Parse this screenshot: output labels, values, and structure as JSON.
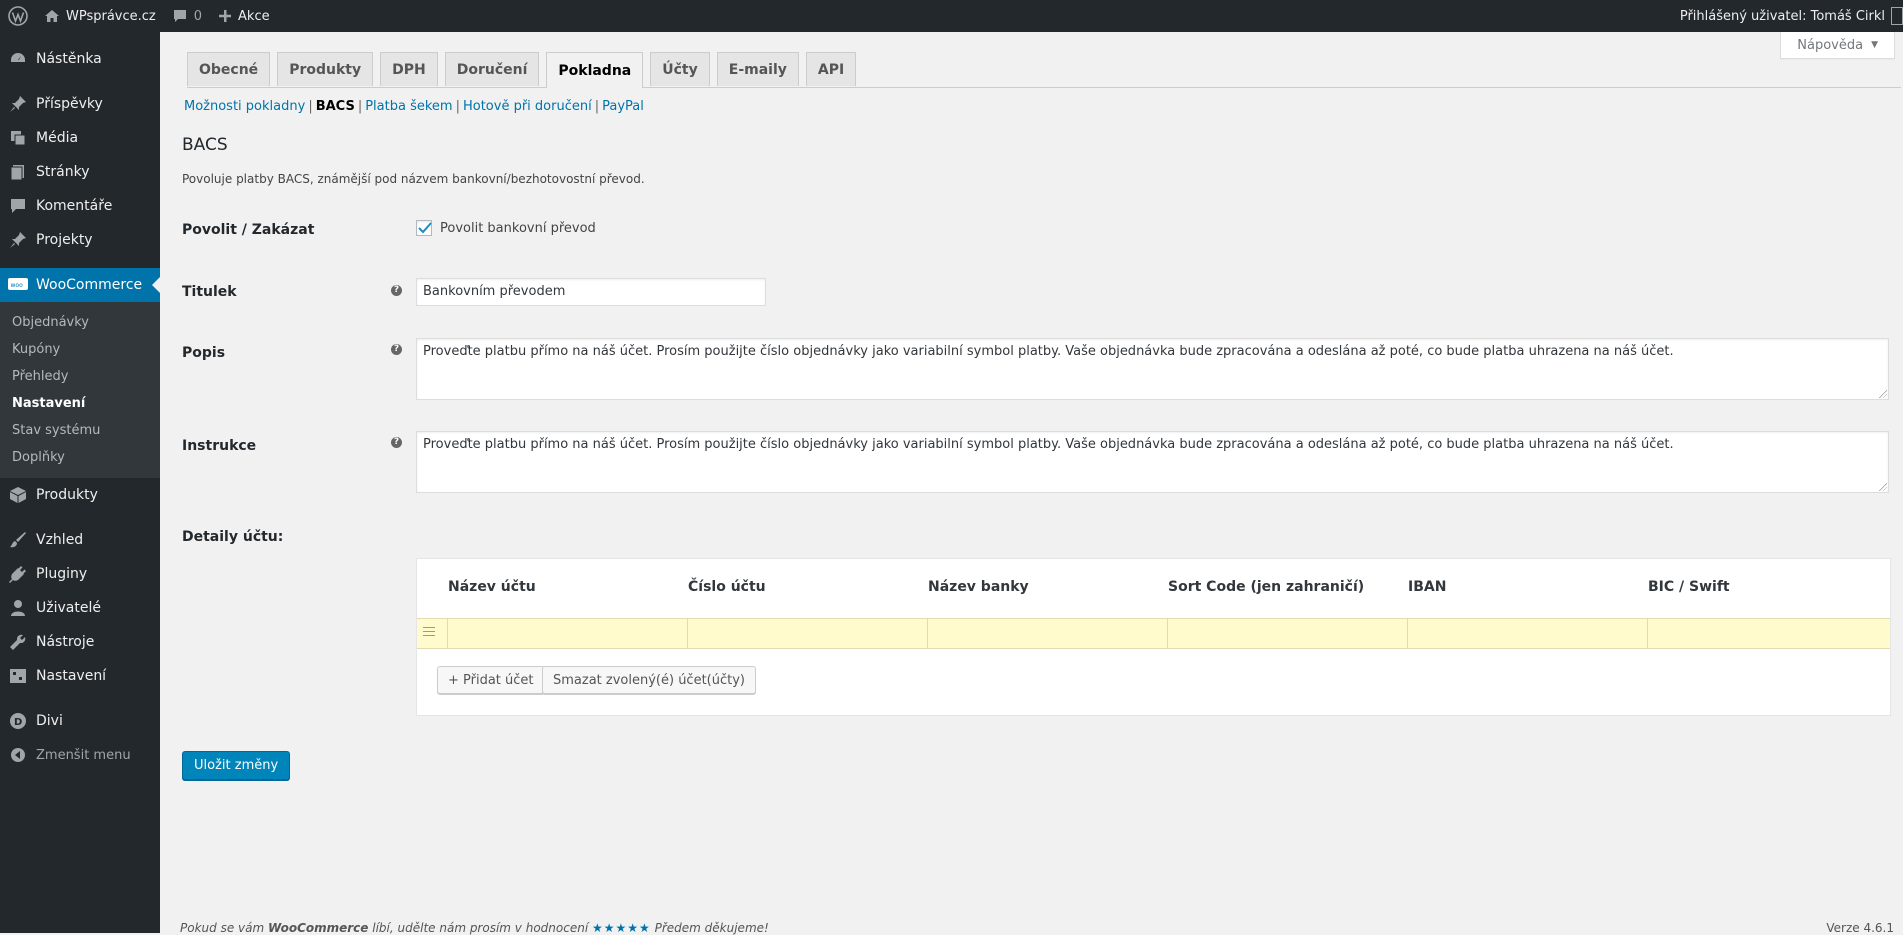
{
  "adminbar": {
    "site_name": "WPsprávce.cz",
    "comments_count": "0",
    "new_label": "Akce",
    "user_greeting": "Přihlášený uživatel: Tomáš Cirkl"
  },
  "sidebar": {
    "items": [
      {
        "label": "Nástěnka",
        "icon": "dashboard-icon"
      },
      {
        "label": "Příspěvky",
        "icon": "pin-icon"
      },
      {
        "label": "Média",
        "icon": "media-icon"
      },
      {
        "label": "Stránky",
        "icon": "pages-icon"
      },
      {
        "label": "Komentáře",
        "icon": "comment-icon"
      },
      {
        "label": "Projekty",
        "icon": "pin-icon"
      },
      {
        "label": "WooCommerce",
        "icon": "woo-icon"
      },
      {
        "label": "Produkty",
        "icon": "box-icon"
      },
      {
        "label": "Vzhled",
        "icon": "brush-icon"
      },
      {
        "label": "Pluginy",
        "icon": "plug-icon"
      },
      {
        "label": "Uživatelé",
        "icon": "user-icon"
      },
      {
        "label": "Nástroje",
        "icon": "wrench-icon"
      },
      {
        "label": "Nastavení",
        "icon": "settings-icon"
      },
      {
        "label": "Divi",
        "icon": "divi-icon"
      }
    ],
    "woo_submenu": [
      "Objednávky",
      "Kupóny",
      "Přehledy",
      "Nastavení",
      "Stav systému",
      "Doplňky"
    ],
    "collapse_label": "Zmenšit menu"
  },
  "help_tab": "Nápověda",
  "tabs": [
    "Obecné",
    "Produkty",
    "DPH",
    "Doručení",
    "Pokladna",
    "Účty",
    "E-maily",
    "API"
  ],
  "subnav": {
    "links": [
      "Možnosti pokladny",
      "BACS",
      "Platba šekem",
      "Hotově při doručení",
      "PayPal"
    ]
  },
  "section": {
    "title": "BACS",
    "description": "Povoluje platby BACS, známější pod názvem bankovní/bezhotovostní převod."
  },
  "form": {
    "enable_label": "Povolit / Zakázat",
    "enable_checkbox_label": "Povolit bankovní převod",
    "title_label": "Titulek",
    "title_value": "Bankovním převodem",
    "desc_label": "Popis",
    "desc_value": "Proveďte platbu přímo na náš účet. Prosím použijte číslo objednávky jako variabilní symbol platby. Vaše objednávka bude zpracována a odeslána až poté, co bude platba uhrazena na náš účet.",
    "instr_label": "Instrukce",
    "instr_value": "Proveďte platbu přímo na náš účet. Prosím použijte číslo objednávky jako variabilní symbol platby. Vaše objednávka bude zpracována a odeslána až poté, co bude platba uhrazena na náš účet.",
    "accounts_label": "Detaily účtu:",
    "accounts_columns": [
      "Název účtu",
      "Číslo účtu",
      "Název banky",
      "Sort Code (jen zahraničí)",
      "IBAN",
      "BIC / Swift"
    ],
    "add_account": "+ Přidat účet",
    "remove_account": "Smazat zvolený(é) účet(účty)",
    "save": "Uložit změny"
  },
  "footer": {
    "text_before": "Pokud se vám",
    "brand": "WooCommerce",
    "text_middle": "líbí, udělte nám prosím v hodnocení",
    "stars": "★★★★★",
    "text_after": "Předem děkujeme!",
    "version": "Verze 4.6.1"
  },
  "colors": {
    "admin_dark": "#23282d",
    "accent": "#0073aa",
    "primary_button": "#0085ba",
    "highlight_row": "#fffbcc"
  }
}
